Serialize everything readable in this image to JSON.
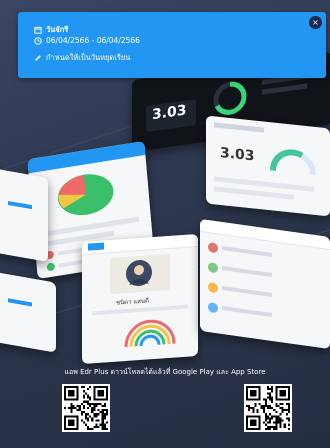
{
  "notification": {
    "title": "วันจักรี",
    "date_range": "06/04/2566 - 06/04/2566",
    "note": "กำหนดให้เป็นวันหยุดเรียน",
    "close_label": "×"
  },
  "mockups": {
    "score_value_1": "3.03",
    "score_value_2": "3.03",
    "student_name": "ชนิดา แสนดี"
  },
  "footer": {
    "promo_text": "แอพ Edr Plus ดาวน์โหลดได้แล้วที่ Google Play และ App Store"
  },
  "colors": {
    "accent": "#2196f3",
    "background": "#2e3850"
  }
}
